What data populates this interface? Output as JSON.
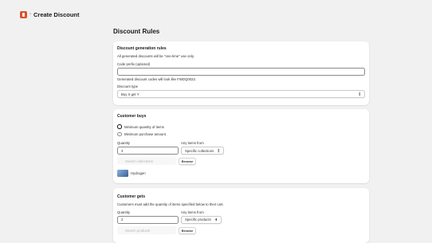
{
  "header": {
    "separator": "›",
    "title": "Create Discount"
  },
  "page_title": "Discount Rules",
  "generation": {
    "title": "Discount generation rules",
    "note": "All generated discounts will be \"one-time\" use only.",
    "prefix_label": "Code prefix (optional)",
    "prefix_value": "",
    "prefix_help": "Generated discount codes will look like FWDQ0022.",
    "type_label": "Discount type",
    "type_value": "Buy X get Y"
  },
  "buys": {
    "title": "Customer buys",
    "option_quantity": "Minimum quantity of items",
    "option_amount": "Minimum purchase amount",
    "selected_option": "Minimum quantity of items",
    "quantity_label": "Quantity",
    "quantity_value": "3",
    "items_from_label": "Any items from",
    "items_from_value": "Specific collections",
    "search_placeholder": "Search collections",
    "browse_label": "Browse",
    "collection_name": "Hydrogen"
  },
  "gets": {
    "title": "Customer gets",
    "note": "Customers must add the quantity of items specified below to their cart.",
    "quantity_label": "Quantity",
    "quantity_value": "2",
    "items_from_label": "Any items from",
    "items_from_value": "Specific products",
    "search_placeholder": "Search products",
    "browse_label": "Browse"
  },
  "colors": {
    "background": "#f1f1f1",
    "card": "#ffffff",
    "brand_icon": "#d9532b"
  }
}
